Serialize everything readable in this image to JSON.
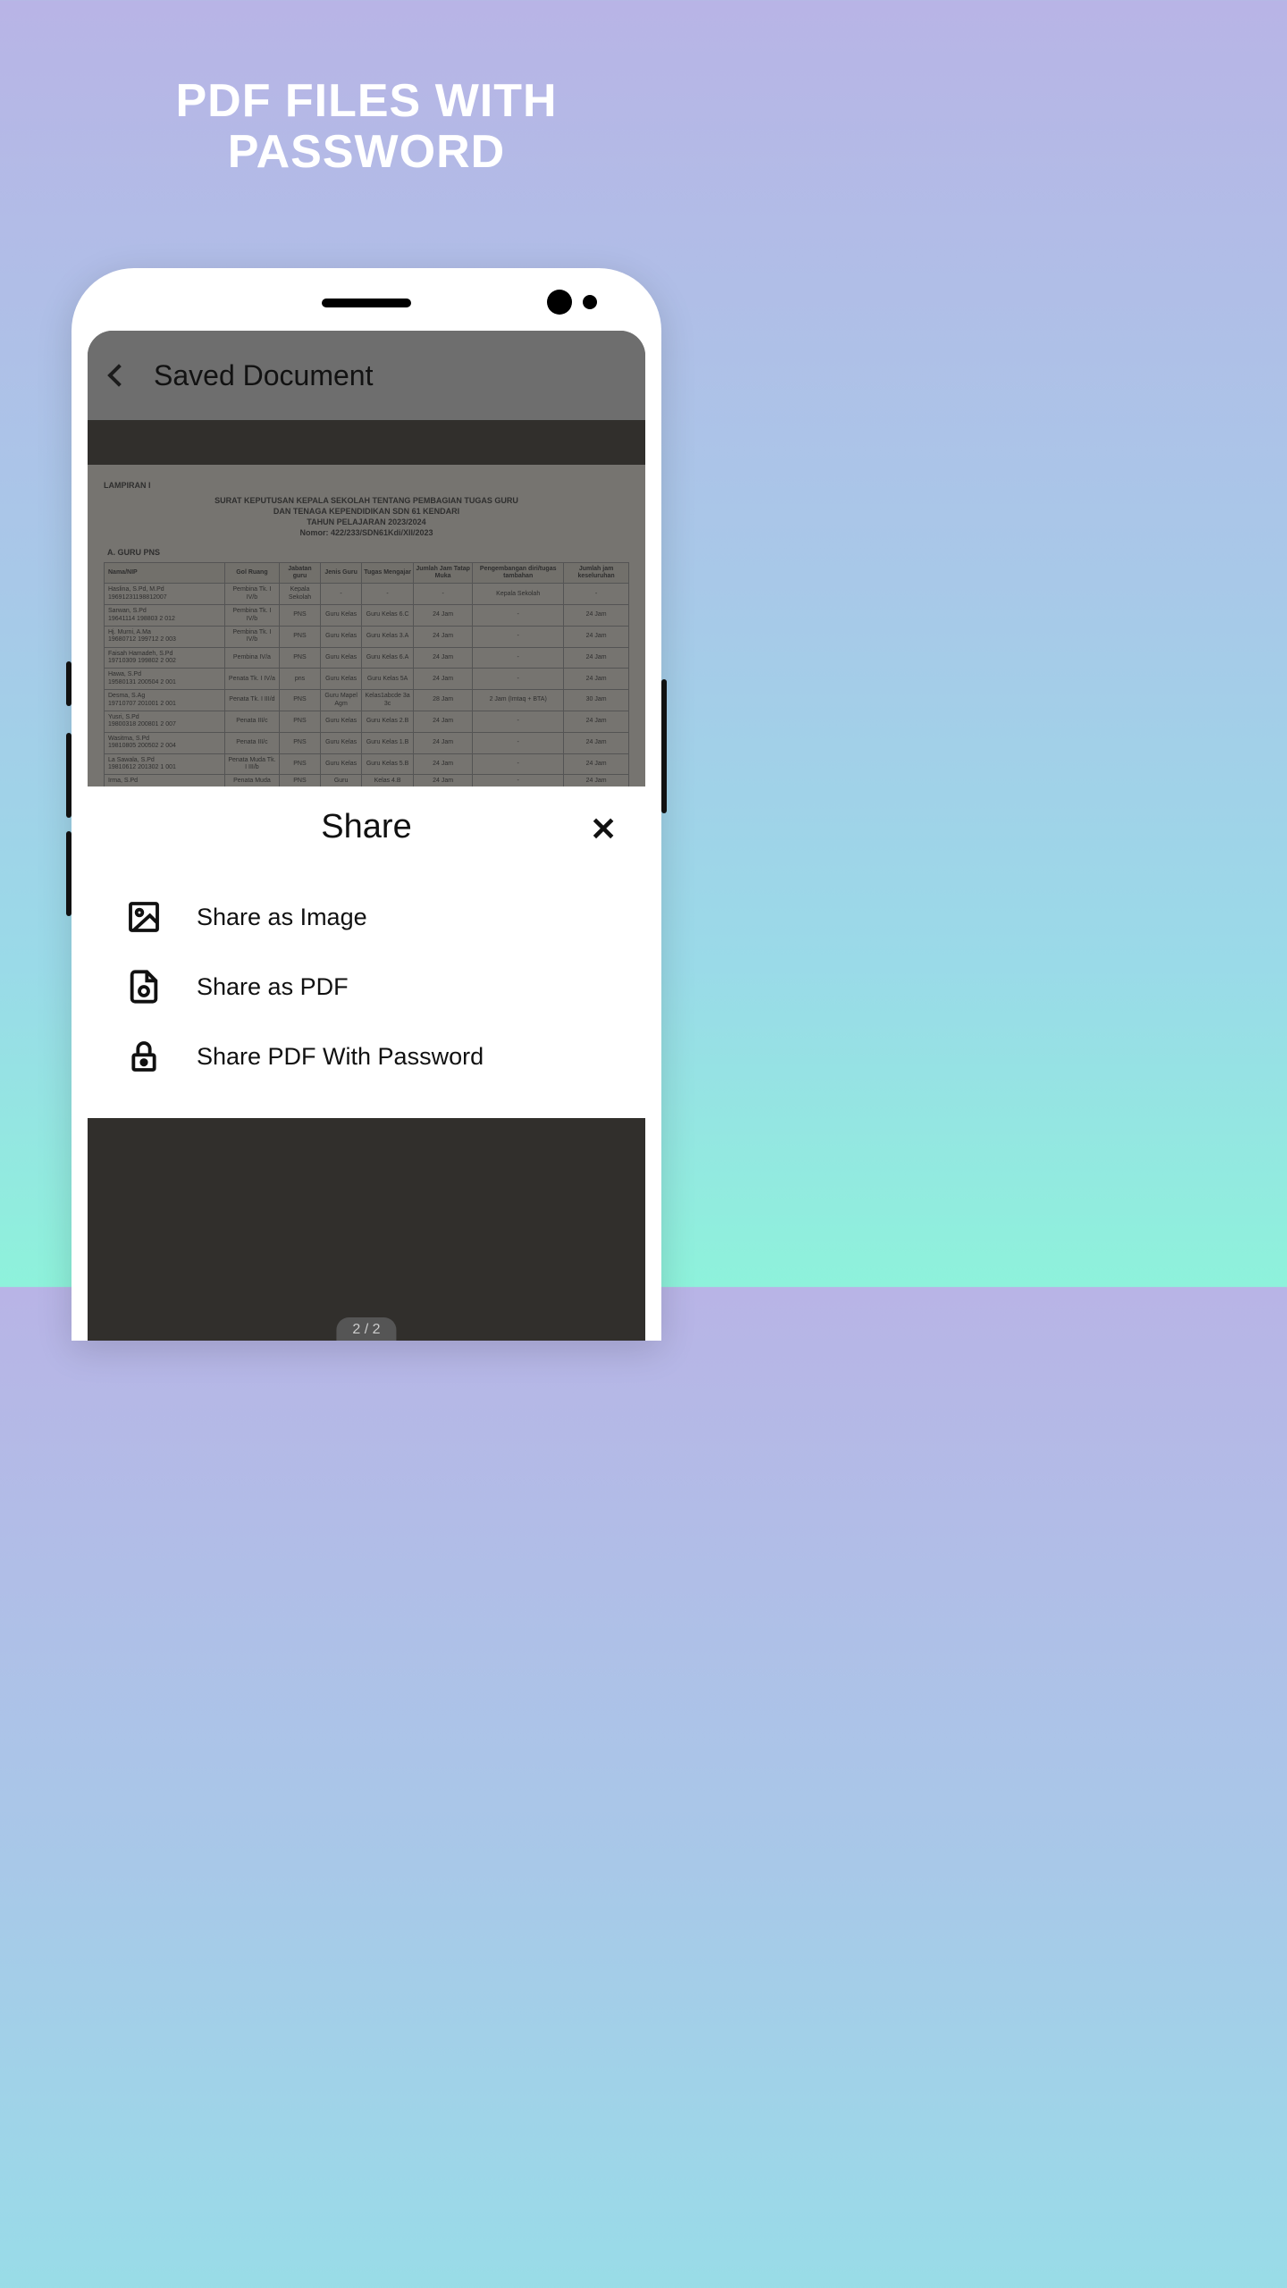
{
  "promo": {
    "line1": "PDF FILES WITH",
    "line2": "PASSWORD"
  },
  "app": {
    "header_title": "Saved Document",
    "page_indicator": "2 / 2"
  },
  "share": {
    "title": "Share",
    "items": [
      {
        "icon": "image-icon",
        "label": "Share as Image"
      },
      {
        "icon": "pdf-icon",
        "label": "Share as PDF"
      },
      {
        "icon": "lock-icon",
        "label": "Share PDF With Password"
      }
    ]
  },
  "document": {
    "lampiran": "LAMPIRAN I",
    "title_line1": "SURAT KEPUTUSAN KEPALA SEKOLAH TENTANG PEMBAGIAN TUGAS GURU",
    "title_line2": "DAN TENAGA KEPENDIDIKAN SDN 61 KENDARI",
    "title_line3": "TAHUN PELAJARAN 2023/2024",
    "title_line4": "Nomor: 422/233/SDN61Kdi/XII/2023",
    "section": "A. GURU PNS",
    "headers": [
      "Nama/NIP",
      "Gol Ruang",
      "Jabatan guru",
      "Jenis Guru",
      "Tugas Mengajar",
      "Jumlah Jam Tatap Muka",
      "Pengembangan diri/tugas tambahan",
      "Jumlah jam keseluruhan"
    ],
    "rows": [
      [
        "Haslina, S.Pd, M.Pd\n19691231198812007",
        "Pembina Tk. I IV/b",
        "Kepala Sekolah",
        "-",
        "-",
        "-",
        "Kepala Sekolah",
        "-"
      ],
      [
        "Sarwan, S.Pd\n19641114 198803 2 012",
        "Pembina Tk. I IV/b",
        "PNS",
        "Guru Kelas",
        "Guru Kelas 6.C",
        "24 Jam",
        "-",
        "24 Jam"
      ],
      [
        "Hj. Murni, A.Ma\n19680712 199712 2 003",
        "Pembina Tk. I IV/b",
        "PNS",
        "Guru Kelas",
        "Guru Kelas 3.A",
        "24 Jam",
        "-",
        "24 Jam"
      ],
      [
        "Faisah Hamadeh, S.Pd\n19710309 199802 2 002",
        "Pembina IV/a",
        "PNS",
        "Guru Kelas",
        "Guru Kelas 6.A",
        "24 Jam",
        "-",
        "24 Jam"
      ],
      [
        "Hawa, S.Pd\n19580131 200504 2 001",
        "Penata Tk. I IV/a",
        "pns",
        "Guru Kelas",
        "Guru Kelas 5A",
        "24 Jam",
        "-",
        "24 Jam"
      ],
      [
        "Desma, S.Ag\n19710707 201001 2 001",
        "Penata Tk. I III/d",
        "PNS",
        "Guru Mapel Agm",
        "Kelas1abcde 3a 3c",
        "28 Jam",
        "2 Jam (Imtaq + BTA)",
        "30 Jam"
      ],
      [
        "Yusri, S.Pd\n19800318 200801 2 007",
        "Penata III/c",
        "PNS",
        "Guru Kelas",
        "Guru Kelas 2.B",
        "24 Jam",
        "-",
        "24 Jam"
      ],
      [
        "Wasitma, S.Pd\n19810805 200502 2 004",
        "Penata III/c",
        "PNS",
        "Guru Kelas",
        "Guru Kelas 1.B",
        "24 Jam",
        "-",
        "24 Jam"
      ],
      [
        "La Sawala, S.Pd\n19810612 201302 1 001",
        "Penata Muda Tk. I III/b",
        "PNS",
        "Guru Kelas",
        "Guru Kelas 5.B",
        "24 Jam",
        "-",
        "24 Jam"
      ],
      [
        "Irma, S.Pd",
        "Penata Muda",
        "PNS",
        "Guru",
        "Kelas 4.B",
        "24 Jam",
        "-",
        "24 Jam"
      ]
    ]
  }
}
